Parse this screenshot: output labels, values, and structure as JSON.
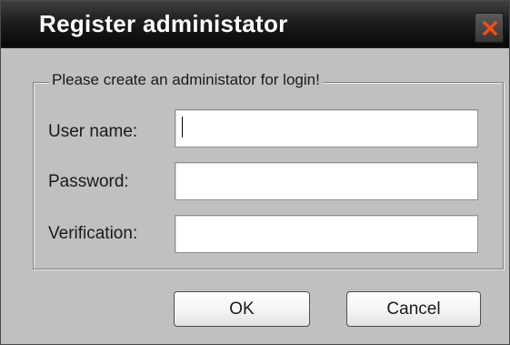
{
  "dialog": {
    "title": "Register administator",
    "close_icon": "close-x-icon",
    "close_icon_color": "#ff4a0f"
  },
  "group": {
    "legend": "Please create an administator for login!"
  },
  "fields": {
    "username": {
      "label": "User name:",
      "value": ""
    },
    "password": {
      "label": "Password:",
      "value": ""
    },
    "verification": {
      "label": "Verification:",
      "value": ""
    }
  },
  "buttons": {
    "ok_label": "OK",
    "cancel_label": "Cancel"
  }
}
